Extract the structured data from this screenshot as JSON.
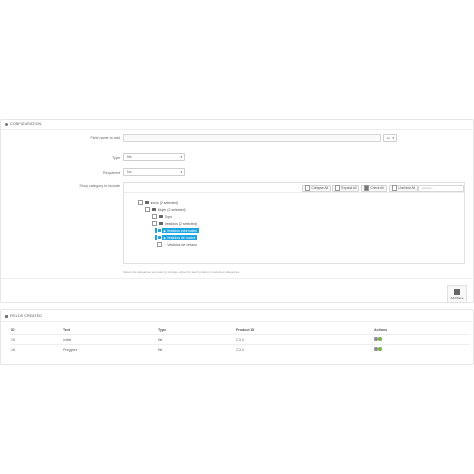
{
  "config": {
    "title": "CONFIGURATION",
    "field_name": {
      "label": "Field name to add",
      "value": "",
      "lang": "en"
    },
    "type": {
      "label": "Type",
      "value": "file"
    },
    "required": {
      "label": "Requiered",
      "value": "No"
    },
    "categories": {
      "label": "Shop category to include",
      "buttons": [
        "Collapse All",
        "Expand All",
        "Check All",
        "Uncheck All"
      ],
      "search_placeholder": "search...",
      "tree": [
        {
          "label": "Inicio (2 selected)",
          "level": 0
        },
        {
          "label": "Mujer (2 selected)",
          "level": 1
        },
        {
          "label": "Tops",
          "level": 2
        },
        {
          "label": "Vestidos (2 selected)",
          "level": 2
        },
        {
          "label": "Vestidos informales",
          "level": 3,
          "selected": true
        },
        {
          "label": "Vestidos de noche",
          "level": 3,
          "selected": true
        },
        {
          "label": "Vestidos de verano",
          "level": 3,
          "selected": false
        }
      ],
      "hint": "Select the categories you want to change prices for each product in selected categories."
    },
    "save_label": "Add/Save"
  },
  "fields": {
    "title": "FIELDS CREATED",
    "columns": [
      "ID",
      "Text",
      "Type",
      "Product ID",
      "Actions"
    ],
    "rows": [
      {
        "id": "15",
        "text": "Initial",
        "type": "file",
        "product_id": "2,3,4"
      },
      {
        "id": "16",
        "text": "Preggers",
        "type": "file",
        "product_id": "2,3,4"
      }
    ]
  },
  "colors": {
    "accent": "#1ca5e0",
    "edit": "#7bb34e",
    "delete": "#8e8e8e"
  }
}
